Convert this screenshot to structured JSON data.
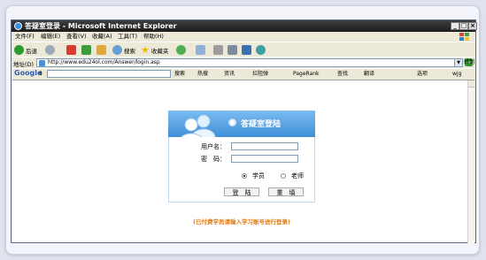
{
  "window": {
    "title": "答疑室登录 - Microsoft Internet Explorer",
    "minimize": "_",
    "maximize": "□",
    "close": "×"
  },
  "menu": [
    "文件(F)",
    "编辑(E)",
    "查看(V)",
    "收藏(A)",
    "工具(T)",
    "帮助(H)"
  ],
  "toolbar": {
    "back": "后退",
    "search": "搜索",
    "favorites": "收藏夹"
  },
  "address": {
    "label": "地址(D)",
    "url": "http://www.edu24ol.com/Answer/login.asp",
    "go": "转到"
  },
  "google_bar": {
    "logo": "Google",
    "g_label": "8",
    "search_btn": "搜索",
    "hot": "热搜",
    "news": "资讯",
    "block": "拦阻弹",
    "pagerank": "PageRank",
    "find": "查找",
    "translate": "翻译",
    "options": "选项",
    "wjg": "wjg"
  },
  "login": {
    "title": "答疑室登陆",
    "username_label": "用户名：",
    "password_label": "密　码：",
    "role_student": "学员",
    "role_teacher": "老师",
    "login_button": "登　陆",
    "reset_button": "重　填",
    "note": "(已付费学员请输入学习账号进行登录)"
  },
  "colors": {
    "accent": "#3f8fd8",
    "note": "#e07a10"
  }
}
